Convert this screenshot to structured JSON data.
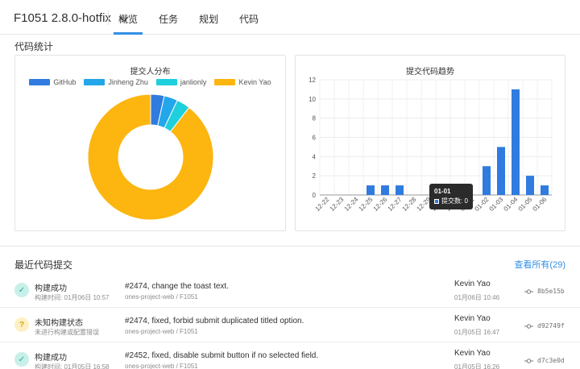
{
  "header": {
    "project": "F1051 2.8.0-hotfix",
    "tabs": [
      {
        "label": "概览",
        "active": true
      },
      {
        "label": "任务",
        "active": false
      },
      {
        "label": "规划",
        "active": false
      },
      {
        "label": "代码",
        "active": false
      }
    ]
  },
  "stats": {
    "title": "代码统计"
  },
  "pie_card": {
    "title": "提交人分布",
    "chart_data": {
      "type": "pie",
      "labels": [
        "GitHub",
        "Jinheng Zhu",
        "janlionly",
        "Kevin Yao"
      ],
      "values": [
        3.5,
        3.5,
        3.5,
        89.5
      ],
      "colors": [
        "#2f7be0",
        "#23a6ea",
        "#1fcfdc",
        "#fdb50f"
      ],
      "donut": true
    }
  },
  "bar_card": {
    "title": "提交代码趋势",
    "chart_data": {
      "type": "bar",
      "categories": [
        "12-22",
        "12-23",
        "12-24",
        "12-25",
        "12-26",
        "12-27",
        "12-28",
        "12-29",
        "12-30",
        "12-31",
        "01-01",
        "01-02",
        "01-03",
        "01-04",
        "01-05",
        "01-06"
      ],
      "values": [
        0,
        0,
        0,
        1,
        1,
        1,
        0,
        0,
        0,
        0,
        0,
        3,
        5,
        11,
        2,
        1
      ],
      "ylim": [
        0,
        12
      ],
      "yticks": [
        0,
        2,
        4,
        6,
        8,
        10,
        12
      ],
      "color": "#2f7be0",
      "grid": true
    },
    "tooltip": {
      "date": "01-01",
      "label": "提交数: 0"
    }
  },
  "recent": {
    "title": "最近代码提交",
    "view_all": "查看所有(29)",
    "commits": [
      {
        "status": "ok",
        "status_glyph": "✓",
        "status_title": "构建成功",
        "status_sub": "构建时间: 01月06日 10:57",
        "message": "#2474, change the toast text.",
        "repo": "ones-project-web / F1051",
        "author": "Kevin Yao",
        "date": "01月06日 10:46",
        "hash": "8b5e15b"
      },
      {
        "status": "unk",
        "status_glyph": "?",
        "status_title": "未知构建状态",
        "status_sub": "未进行构建或配置错误",
        "message": "#2474, fixed, forbid submit duplicated titled option.",
        "repo": "ones-project-web / F1051",
        "author": "Kevin Yao",
        "date": "01月05日 16:47",
        "hash": "d92749f"
      },
      {
        "status": "ok",
        "status_glyph": "✓",
        "status_title": "构建成功",
        "status_sub": "构建时间: 01月05日 16:58",
        "message": "#2452, fixed, disable submit button if no selected field.",
        "repo": "ones-project-web / F1051",
        "author": "Kevin Yao",
        "date": "01月05日 16:26",
        "hash": "d7c3e0d"
      }
    ]
  }
}
